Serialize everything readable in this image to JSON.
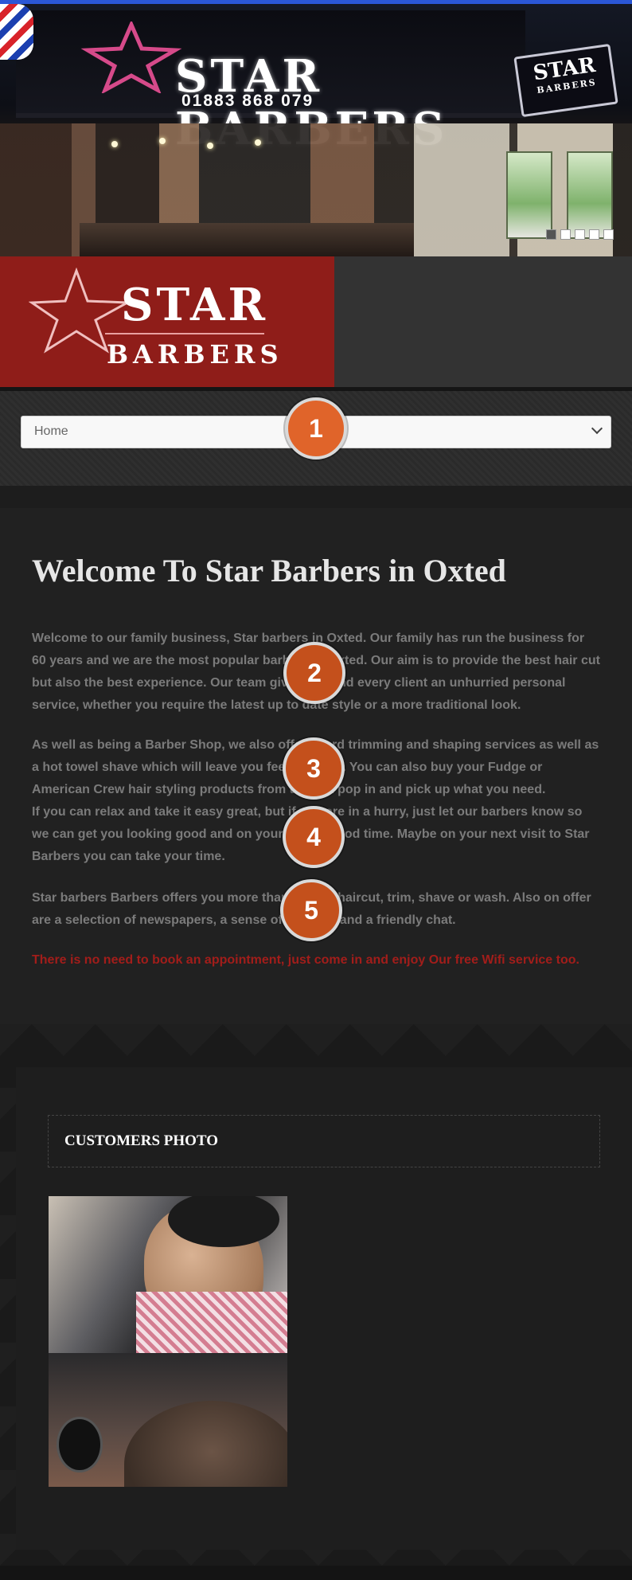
{
  "hero": {
    "sign_title": "STAR BARBERS",
    "sign_phone": "01883 868 079",
    "mini_sign_line1": "STAR",
    "mini_sign_line2": "BARBERS",
    "slides": 5,
    "active_slide": 1
  },
  "logo": {
    "line1": "STAR",
    "line2": "BARBERS",
    "bg_color": "#8f1d19"
  },
  "nav": {
    "selected": "Home"
  },
  "main": {
    "heading": "Welcome To Star Barbers in Oxted",
    "paragraphs": [
      "Welcome to our family business, Star barbers in Oxted. Our family has run the business for 60 years and we are the most popular barbers in Oxted. Our aim is to provide the best hair cut but also the best experience.  Our team give each and every client an unhurried personal service, whether you require the latest up to date style or a more traditional look.",
      "As well as being a Barber Shop, we also offer beard trimming and shaping services as well as a hot towel shave which will leave you feeling great. You can also buy your Fudge or American Crew hair styling products from us, just pop in and pick up what you need.",
      "If you can relax and take it easy great, but if you are in a hurry, just let our barbers know so we can get you looking good and on your way in good time. Maybe on your next visit to Star Barbers you can take your time.",
      "Star barbers Barbers offers you more than a great haircut, trim, shave or wash. Also on offer are a selection of newspapers, a sense of humour, and a friendly chat."
    ],
    "notice": "There is no need to book an appointment, just come in and enjoy Our free Wifi service too.",
    "notice_color": "#a21d1a"
  },
  "customers": {
    "title": "CUSTOMERS PHOTO"
  },
  "markers": [
    "1",
    "2",
    "3",
    "4",
    "5"
  ],
  "colors": {
    "accent_top": "#2b57d6",
    "marker": "#c4501c"
  }
}
